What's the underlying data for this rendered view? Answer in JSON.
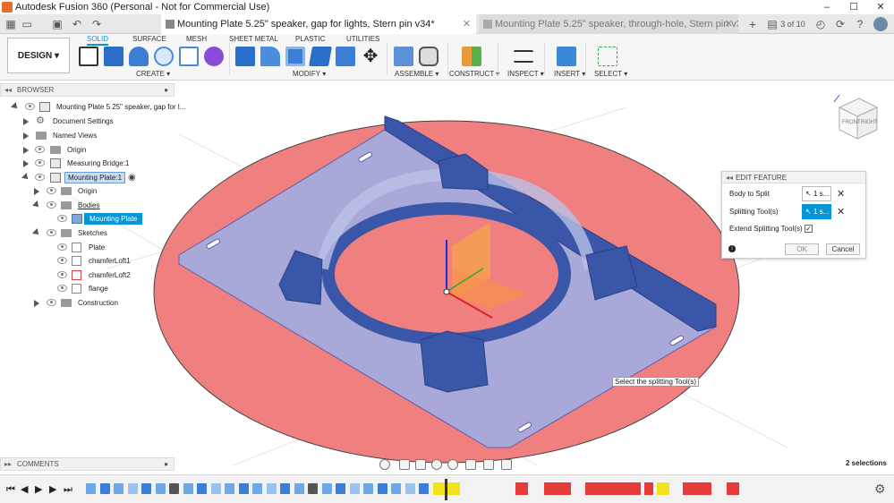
{
  "window": {
    "title": "Autodesk Fusion 360 (Personal - Not for Commercial Use)",
    "controls": [
      "–",
      "☐",
      "✕"
    ]
  },
  "tabs": [
    {
      "label": "Mounting Plate 5.25\" speaker, gap for lights, Stern pin v34*",
      "active": true
    },
    {
      "label": "Mounting Plate 5.25\" speaker, through-hole, Stern pin v34*",
      "active": false
    }
  ],
  "tab_counter": "3 of 10",
  "ribbon": {
    "workspace": "DESIGN ▾",
    "tabs": [
      "SOLID",
      "SURFACE",
      "MESH",
      "SHEET METAL",
      "PLASTIC",
      "UTILITIES"
    ],
    "active_tab": "SOLID",
    "groups": [
      "CREATE ▾",
      "MODIFY ▾",
      "ASSEMBLE ▾",
      "CONSTRUCT ▾",
      "INSPECT ▾",
      "INSERT ▾",
      "SELECT ▾"
    ]
  },
  "browser": {
    "title": "BROWSER",
    "items": [
      {
        "label": "Mounting Plate 5.25\" speaker, gap for l..."
      },
      {
        "label": "Document Settings"
      },
      {
        "label": "Named Views"
      },
      {
        "label": "Origin"
      },
      {
        "label": "Measuring Bridge:1"
      },
      {
        "label": "Mounting Plate:1"
      },
      {
        "label": "Origin"
      },
      {
        "label": "Bodies"
      },
      {
        "label": "Mounting Plate"
      },
      {
        "label": "Sketches"
      },
      {
        "label": "Plate"
      },
      {
        "label": "chamferLoft1"
      },
      {
        "label": "chamferLoft2"
      },
      {
        "label": "flange"
      },
      {
        "label": "Construction"
      }
    ]
  },
  "edit_feature": {
    "title": "EDIT FEATURE",
    "rows": [
      {
        "label": "Body to Split",
        "value": "1 s..."
      },
      {
        "label": "Splitting Tool(s)",
        "value": "1 s..."
      },
      {
        "label": "Extend Splitting Tool(s)"
      }
    ],
    "ok": "OK",
    "cancel": "Cancel"
  },
  "tooltip": "Select the splitting Tool(s)",
  "comments": "COMMENTS",
  "status": "2 selections",
  "viewcube": {
    "front": "FRONT",
    "right": "RIGHT"
  },
  "colors": {
    "accent": "#0696d7",
    "plane": "#f07878",
    "body": "#3f5fb3",
    "plate": "#a9a8d8"
  }
}
